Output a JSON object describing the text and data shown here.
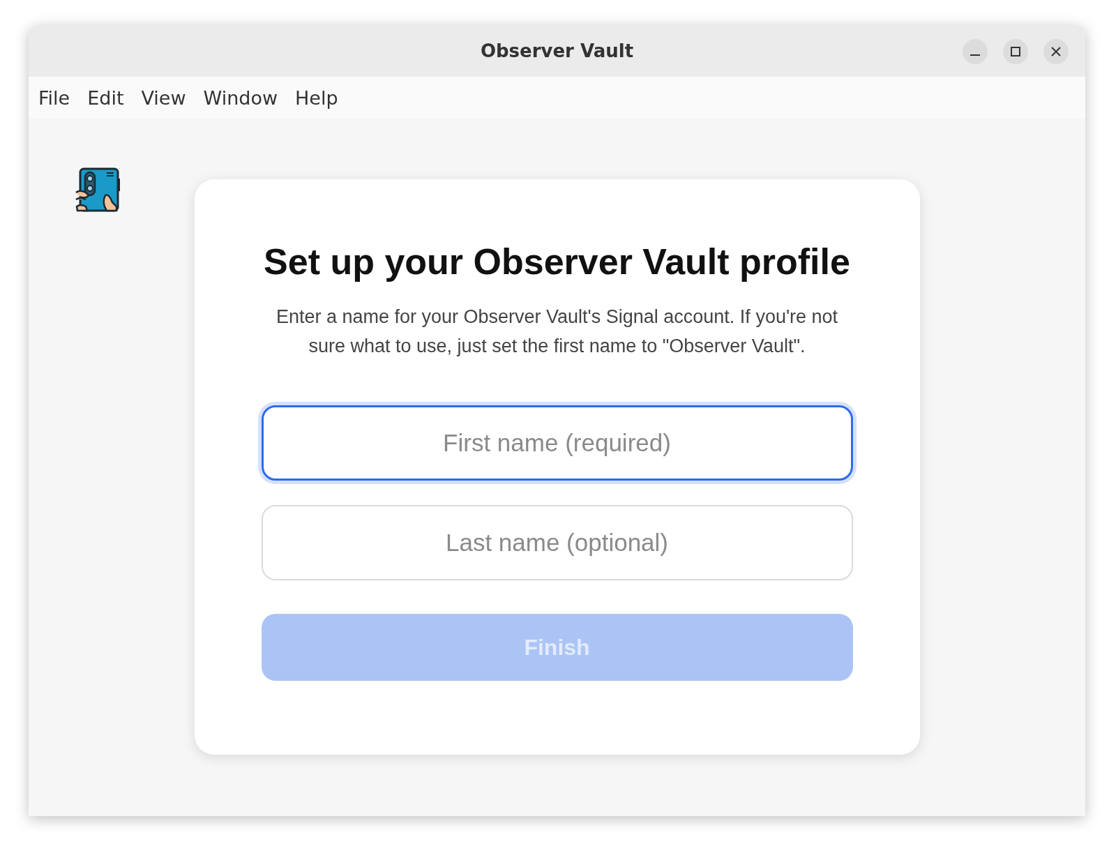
{
  "window": {
    "title": "Observer Vault"
  },
  "menu": [
    "File",
    "Edit",
    "View",
    "Window",
    "Help"
  ],
  "profile": {
    "heading": "Set up your Observer Vault profile",
    "description": "Enter a name for your Observer Vault's Signal account. If you're not sure what to use, just set the first name to \"Observer Vault\".",
    "fields": [
      {
        "placeholder": "First name (required)",
        "focused": true
      },
      {
        "placeholder": "Last name (optional)",
        "focused": false
      }
    ],
    "button": {
      "label": "Finish",
      "disabled": true
    }
  }
}
